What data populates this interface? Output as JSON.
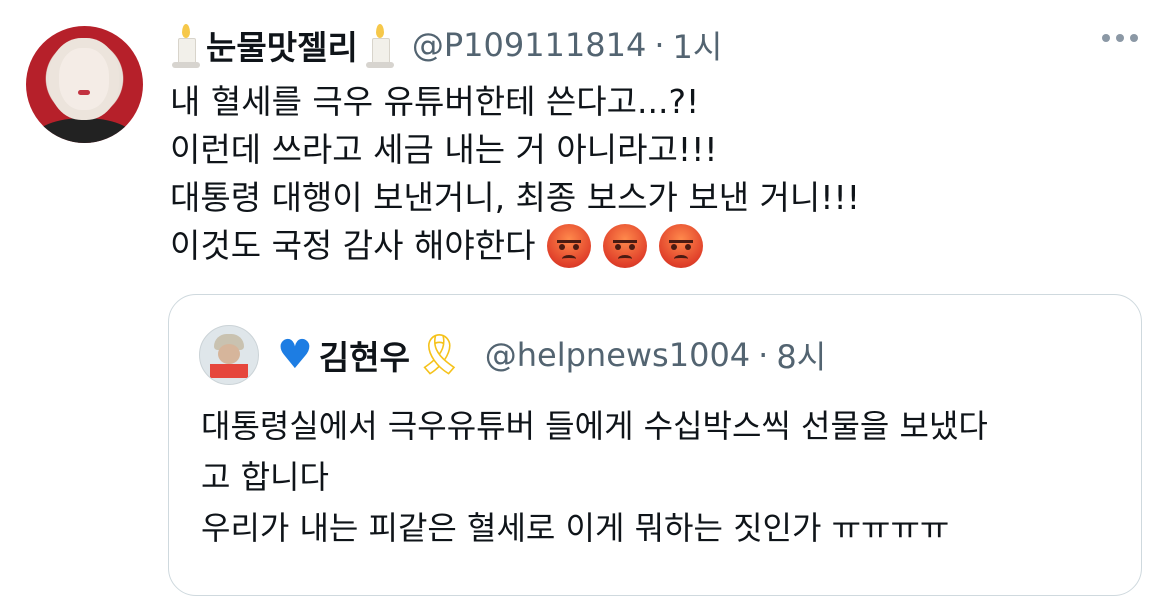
{
  "tweet": {
    "author_name": "눈물맛젤리",
    "author_handle": "@P109111814",
    "separator": "·",
    "time": "1시",
    "lines": [
      "내 혈세를 극우 유튜버한테 쓴다고...?!",
      "이런데 쓰라고 세금 내는 거 아니라고!!!",
      "대통령 대행이 보낸거니, 최종 보스가 보낸 거니!!!",
      "이것도 국정 감사 해야한다"
    ],
    "name_emoji": "candle-icon",
    "trailing_emoji": [
      "angry-face-icon",
      "angry-face-icon",
      "angry-face-icon"
    ]
  },
  "quoted": {
    "name_prefix_emoji": "blue-heart-icon",
    "author_name": "김현우",
    "name_suffix_emoji": "yellow-ribbon-icon",
    "author_handle": "@helpnews1004",
    "separator": "·",
    "time": "8시",
    "lines": [
      "대통령실에서 극우유튜버 들에게 수십박스씩 선물을 보냈다",
      "고 합니다",
      "우리가 내는 피같은 혈세로 이게 뭐하는 짓인가 ㅠㅠㅠㅠ"
    ]
  },
  "colors": {
    "text": "#0f1419",
    "secondary": "#536471",
    "border": "#cfd9de",
    "heart": "#1d7de3",
    "ribbon": "#f5c21b"
  }
}
